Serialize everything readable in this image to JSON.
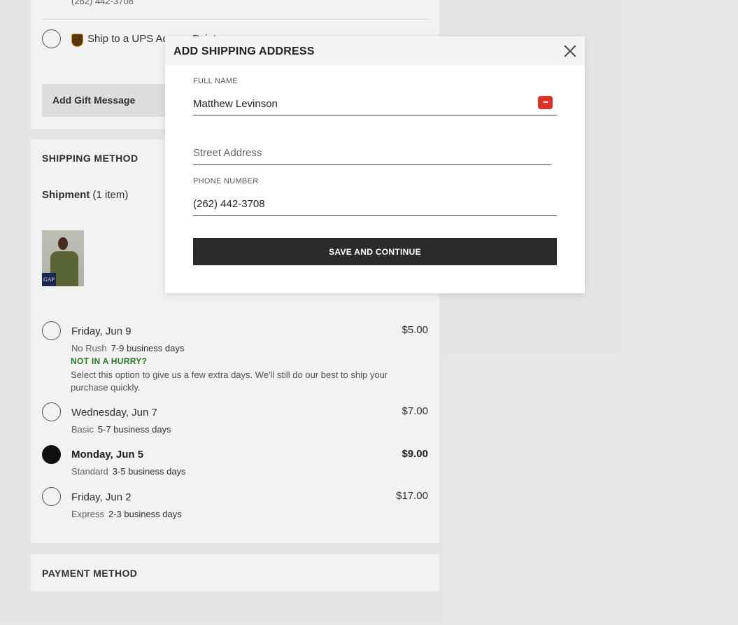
{
  "address": {
    "phone_display": "(262) 442-3708",
    "ups_label": "Ship to a UPS Access Point",
    "gift_label": "Add Gift Message"
  },
  "shipping": {
    "title": "SHIPPING METHOD",
    "shipment_label": "Shipment",
    "shipment_count": "(1 item)",
    "thumb_brand": "GAP",
    "options": [
      {
        "date": "Friday, Jun 9",
        "type": "No Rush",
        "days": "7-9 business days",
        "price": "$5.00",
        "selected": false
      },
      {
        "date": "Wednesday, Jun 7",
        "type": "Basic",
        "days": "5-7 business days",
        "price": "$7.00",
        "selected": false
      },
      {
        "date": "Monday, Jun 5",
        "type": "Standard",
        "days": "3-5 business days",
        "price": "$9.00",
        "selected": true
      },
      {
        "date": "Friday, Jun 2",
        "type": "Express",
        "days": "2-3 business days",
        "price": "$17.00",
        "selected": false
      }
    ],
    "no_rush_heading": "NOT IN A HURRY?",
    "no_rush_desc": "Select this option to give us a few extra days. We'll still do our best to ship your purchase quickly."
  },
  "payment": {
    "title": "PAYMENT METHOD"
  },
  "modal": {
    "title": "ADD SHIPPING ADDRESS",
    "full_name_label": "FULL NAME",
    "full_name_value": "Matthew Levinson",
    "street_placeholder": "Street Address",
    "street_value": "",
    "phone_label": "PHONE NUMBER",
    "phone_value": "(262) 442-3708",
    "save_label": "SAVE AND CONTINUE",
    "password_icon_text": "•••"
  },
  "colors": {
    "selected_radio": "#111111",
    "hurry_green": "#2a7d2a",
    "button_dark": "#2b2b2b",
    "password_icon_red": "#d9322b"
  }
}
